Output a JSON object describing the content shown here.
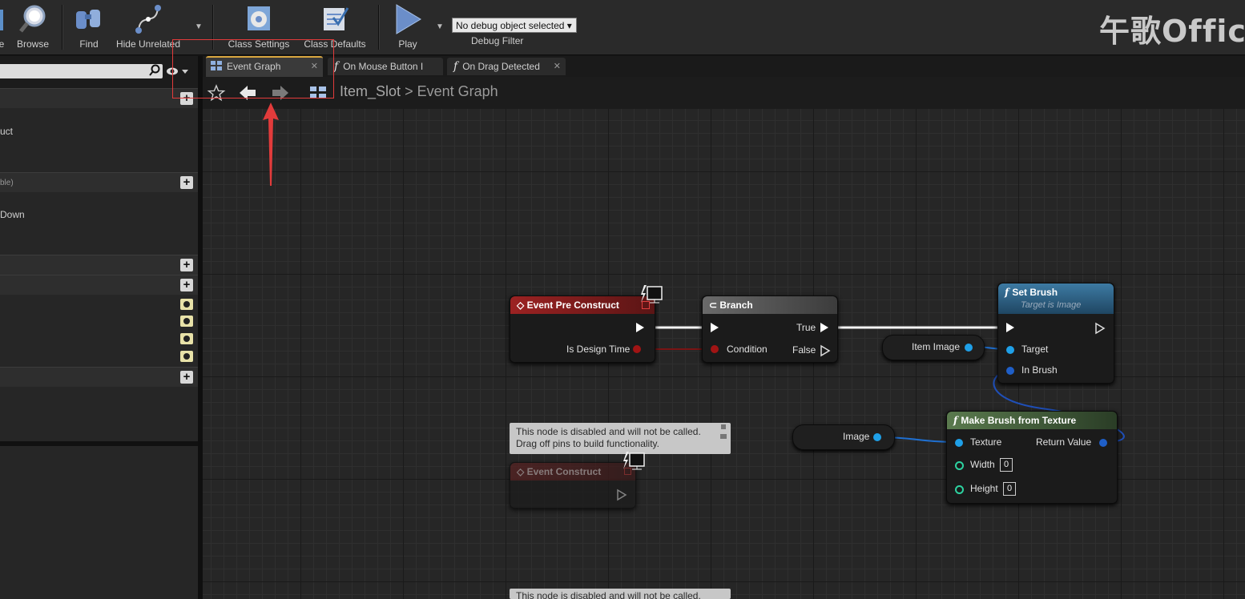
{
  "toolbar": {
    "items": [
      {
        "label": "e",
        "icon": "compile-icon"
      },
      {
        "label": "Browse",
        "icon": "browse-icon"
      },
      {
        "label": "Find",
        "icon": "binoculars-icon"
      },
      {
        "label": "Hide Unrelated",
        "icon": "hide-unrelated-icon"
      },
      {
        "label": "Class Settings",
        "icon": "gear-icon"
      },
      {
        "label": "Class Defaults",
        "icon": "checklist-icon"
      },
      {
        "label": "Play",
        "icon": "play-icon"
      }
    ],
    "debug_select": "No debug object selected",
    "debug_filter": "Debug Filter"
  },
  "watermark": "午歌Offic",
  "left_panel": {
    "items": [
      "uct",
      "ble)",
      "Down"
    ]
  },
  "tabs": [
    {
      "label": "Event Graph",
      "icon": "graph-icon",
      "active": true
    },
    {
      "label": "On Mouse Button I",
      "icon": "function-icon",
      "active": false
    },
    {
      "label": "On Drag Detected",
      "icon": "function-icon",
      "active": false
    }
  ],
  "breadcrumb": {
    "blueprint": "Item_Slot",
    "sep": ">",
    "graph": "Event Graph"
  },
  "nodes": {
    "event_pre_construct": {
      "title": "Event Pre Construct",
      "pin_design_time": "Is Design Time"
    },
    "branch": {
      "title": "Branch",
      "pin_condition": "Condition",
      "pin_true": "True",
      "pin_false": "False"
    },
    "set_brush": {
      "title": "Set Brush",
      "subtitle": "Target is Image",
      "pin_target": "Target",
      "pin_in_brush": "In Brush"
    },
    "item_image": {
      "label": "Item Image"
    },
    "image": {
      "label": "Image"
    },
    "make_brush": {
      "title": "Make Brush from Texture",
      "pin_texture": "Texture",
      "pin_return": "Return Value",
      "pin_width": "Width",
      "pin_height": "Height",
      "width_value": "0",
      "height_value": "0"
    },
    "event_construct": {
      "title": "Event Construct"
    }
  },
  "comments": {
    "disabled_1": "This node is disabled and will not be called.",
    "disabled_2": "Drag off pins to build functionality.",
    "disabled_bottom": "This node is disabled and will not be called."
  },
  "colors": {
    "event_header": "#8a1e1e",
    "branch_header": "#5a5a5a",
    "function_header": "#2f5f80",
    "pure_function_header": "#4e6a44",
    "object_pin": "#1fa0e8",
    "bool_pin": "#9a1010",
    "int_pin": "#2dd2a0",
    "highlight": "#e23b3b"
  }
}
